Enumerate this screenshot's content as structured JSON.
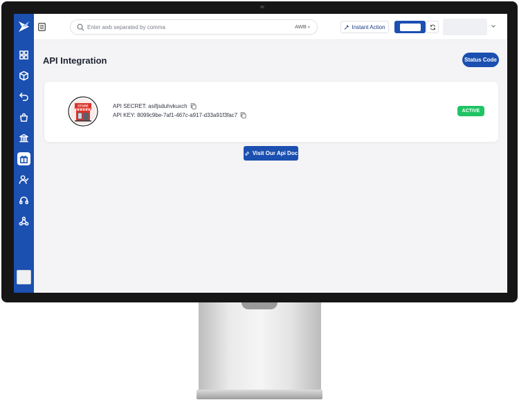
{
  "topbar": {
    "search_placeholder": "Enter awb separated by comma",
    "search_filter": "AWB",
    "instant_action_label": "Instant Action"
  },
  "page": {
    "title": "API Integration",
    "status_code_label": "Status Code"
  },
  "integration_card": {
    "api_secret_text": "API SECRET: asifjsduhvkuxch",
    "api_key_text": "API KEY: 8099c9be-7af1-467c-a917-d33a91f3fac7",
    "store_sign": "STORE",
    "status_badge": "ACTIVE"
  },
  "doc_button_label": "Visit Our Api Doc",
  "colors": {
    "primary": "#1b4fb0",
    "active_badge": "#20c464",
    "store_red": "#d9342b"
  },
  "sidebar": {
    "items": [
      {
        "icon": "dashboard-icon"
      },
      {
        "icon": "package-icon"
      },
      {
        "icon": "return-icon"
      },
      {
        "icon": "shopping-bag-icon"
      },
      {
        "icon": "bank-icon"
      },
      {
        "icon": "integration-gift-icon",
        "active": true
      },
      {
        "icon": "user-check-icon"
      },
      {
        "icon": "headset-icon"
      },
      {
        "icon": "webhook-icon"
      }
    ]
  }
}
